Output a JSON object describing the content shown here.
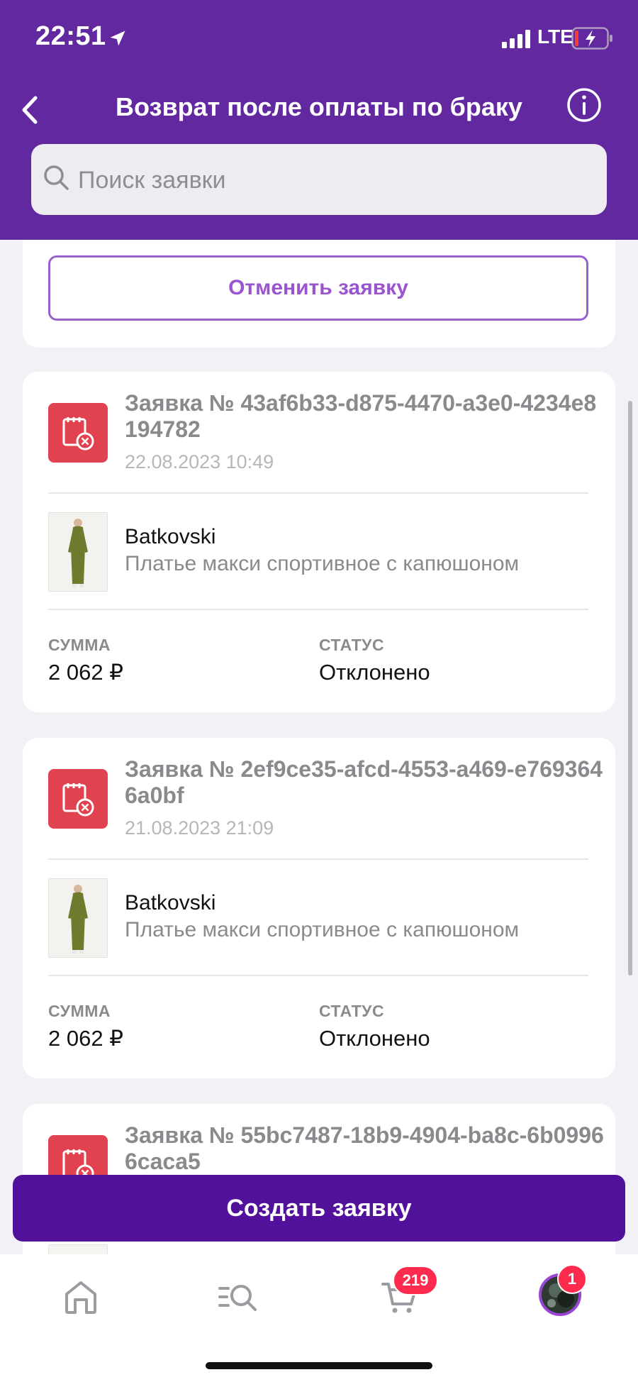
{
  "status_bar": {
    "time": "22:51",
    "network": "LTE"
  },
  "header": {
    "title": "Возврат после оплаты по браку"
  },
  "search": {
    "placeholder": "Поиск заявки"
  },
  "cancel_button": "Отменить заявку",
  "requests": [
    {
      "title": "Заявка № 43af6b33-d875-4470-a3e0-4234e8194782",
      "date": "22.08.2023 10:49",
      "brand": "Batkovski",
      "product": "Платье макси спортивное с капюшоном",
      "sum_label": "СУММА",
      "sum": "2 062 ₽",
      "status_label": "СТАТУС",
      "status": "Отклонено"
    },
    {
      "title": "Заявка № 2ef9ce35-afcd-4553-a469-e7693646a0bf",
      "date": "21.08.2023 21:09",
      "brand": "Batkovski",
      "product": "Платье макси спортивное с капюшоном",
      "sum_label": "СУММА",
      "sum": "2 062 ₽",
      "status_label": "СТАТУС",
      "status": "Отклонено"
    },
    {
      "title": "Заявка № 55bc7487-18b9-4904-ba8c-6b09966caca5"
    }
  ],
  "create_button": "Создать заявку",
  "tabbar": {
    "cart_badge": "219",
    "profile_badge": "1"
  },
  "colors": {
    "header": "#6128a0",
    "primary_button": "#52119a",
    "request_icon": "#e0434f",
    "badge": "#ff2b4f"
  },
  "icons": [
    "location-arrow-icon",
    "signal-icon",
    "battery-icon",
    "back-chevron-icon",
    "info-icon",
    "search-icon",
    "request-rejected-icon",
    "home-icon",
    "catalog-search-icon",
    "cart-icon"
  ]
}
